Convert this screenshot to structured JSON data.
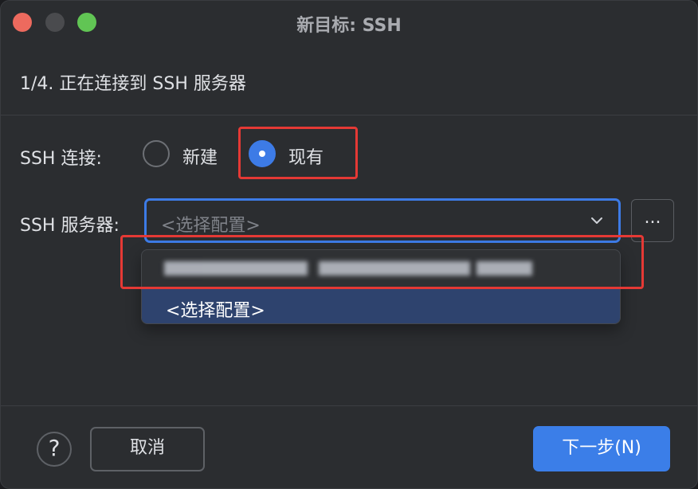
{
  "window": {
    "title": "新目标: SSH"
  },
  "wizard": {
    "step_title": "1/4. 正在连接到 SSH 服务器"
  },
  "connection": {
    "label": "SSH 连接:",
    "options": [
      {
        "label": "新建",
        "selected": false
      },
      {
        "label": "现有",
        "selected": true
      }
    ]
  },
  "server": {
    "label": "SSH 服务器:",
    "placeholder": "<选择配置>",
    "more_button": "...",
    "dropdown_items": [
      {
        "label": ""
      },
      {
        "label": "<选择配置>"
      }
    ]
  },
  "footer": {
    "help": "?",
    "cancel": "取消",
    "next": "下一步(N)"
  },
  "colors": {
    "accent": "#3d7be6",
    "highlight": "#e53935"
  },
  "icons": {
    "chevron": "chevron-down-icon"
  }
}
